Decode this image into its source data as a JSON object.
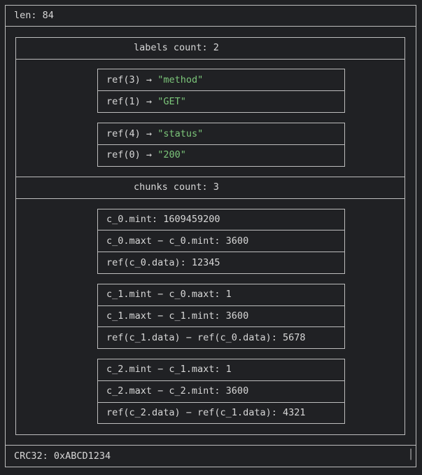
{
  "header": {
    "len_label": "len: 84"
  },
  "labels": {
    "title": "labels count: 2",
    "groups": [
      [
        {
          "ref": "ref(3)",
          "arrow": "→",
          "value": "\"method\""
        },
        {
          "ref": "ref(1)",
          "arrow": "→",
          "value": "\"GET\""
        }
      ],
      [
        {
          "ref": "ref(4)",
          "arrow": "→",
          "value": "\"status\""
        },
        {
          "ref": "ref(0)",
          "arrow": "→",
          "value": "\"200\""
        }
      ]
    ]
  },
  "chunks": {
    "title": "chunks count: 3",
    "groups": [
      [
        "c_0.mint: 1609459200",
        "c_0.maxt − c_0.mint: 3600",
        "ref(c_0.data): 12345"
      ],
      [
        "c_1.mint − c_0.maxt: 1",
        "c_1.maxt − c_1.mint: 3600",
        "ref(c_1.data) − ref(c_0.data): 5678"
      ],
      [
        "c_2.mint − c_1.maxt: 1",
        "c_2.maxt − c_2.mint: 3600",
        "ref(c_2.data) − ref(c_1.data): 4321"
      ]
    ]
  },
  "footer": {
    "crc_label": "CRC32: 0xABCD1234"
  },
  "colors": {
    "background": "#202124",
    "border": "#bdbdbd",
    "text": "#d7d7d7",
    "string": "#7cc67a"
  }
}
